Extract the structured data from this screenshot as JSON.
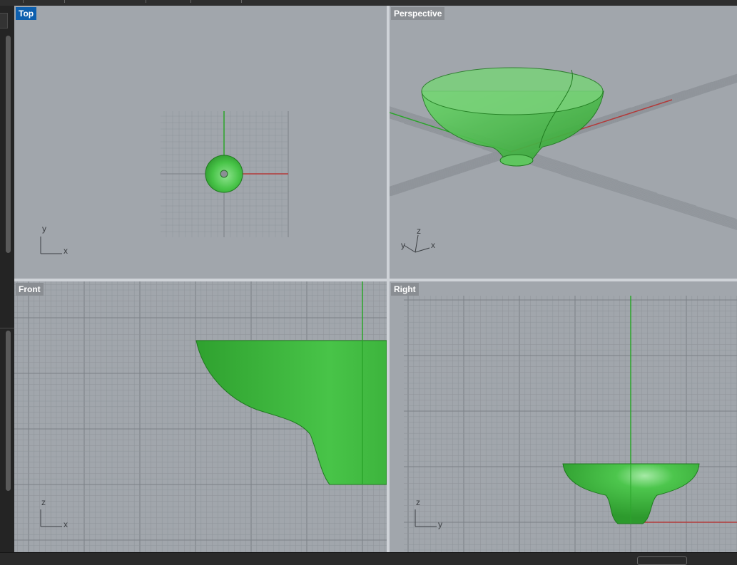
{
  "viewports": {
    "top": {
      "label": "Top",
      "active": true,
      "axis_x": "x",
      "axis_y": "y"
    },
    "perspective": {
      "label": "Perspective",
      "active": false,
      "axis_x": "x",
      "axis_y": "y",
      "axis_z": "z"
    },
    "front": {
      "label": "Front",
      "active": false,
      "axis_h": "x",
      "axis_v": "z"
    },
    "right": {
      "label": "Right",
      "active": false,
      "axis_h": "y",
      "axis_v": "z"
    }
  },
  "colors": {
    "viewport_bg": "#a1a6ac",
    "grid_minor": "#8f949a",
    "grid_major": "#7b8086",
    "x_axis": "#b33a3a",
    "y_axis": "#2aa52a",
    "object_fill": "#3fbf3f",
    "object_edge": "#1f7a1f",
    "active_label": "#0d5fae",
    "label_bg": "#8a8e93"
  },
  "icons": [
    "object-bowl-icon",
    "world-axis-icon"
  ]
}
